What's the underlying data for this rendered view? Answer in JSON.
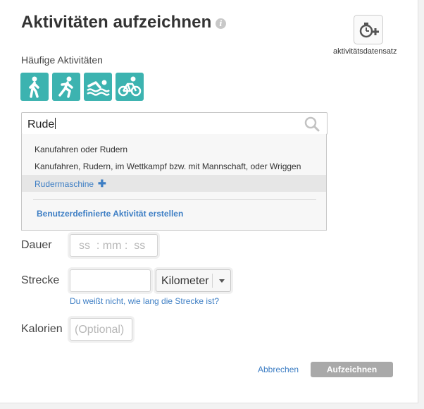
{
  "header": {
    "title": "Aktivitäten aufzeichnen",
    "info": "i"
  },
  "dataset": {
    "label": "aktivitätsdatensatz"
  },
  "frequent": {
    "heading": "Häufige Aktivitäten",
    "tiles": [
      {
        "icon": "walking-icon",
        "color": "#3cb3b0"
      },
      {
        "icon": "running-icon",
        "color": "#3cb3b0"
      },
      {
        "icon": "swimming-icon",
        "color": "#3cb3b0"
      },
      {
        "icon": "cycling-icon",
        "color": "#3cb3b0"
      }
    ]
  },
  "search": {
    "value": "Rude",
    "icon": "search-icon",
    "options": [
      "Kanufahren oder Rudern",
      "Kanufahren, Rudern, im Wettkampf bzw. mit Mannschaft, oder Wriggen",
      "Rudermaschine"
    ],
    "add_icon": "✚",
    "custom_link": "Benutzerdefinierte Aktivität erstellen"
  },
  "form": {
    "duration_label": "Dauer",
    "duration_placeholder": "ss  : mm :  ss",
    "distance_label": "Strecke",
    "distance_value": "",
    "unit_value": "Kilometer",
    "distance_help": "Du weißt nicht, wie lang die Strecke ist?",
    "calories_label": "Kalorien",
    "calories_placeholder": "(Optional)"
  },
  "actions": {
    "cancel": "Abbrechen",
    "save": "Aufzeichnen"
  },
  "colors": {
    "accent": "#3cb3b0",
    "link": "#3d7ec4",
    "disabled_button": "#a9a9a9"
  }
}
